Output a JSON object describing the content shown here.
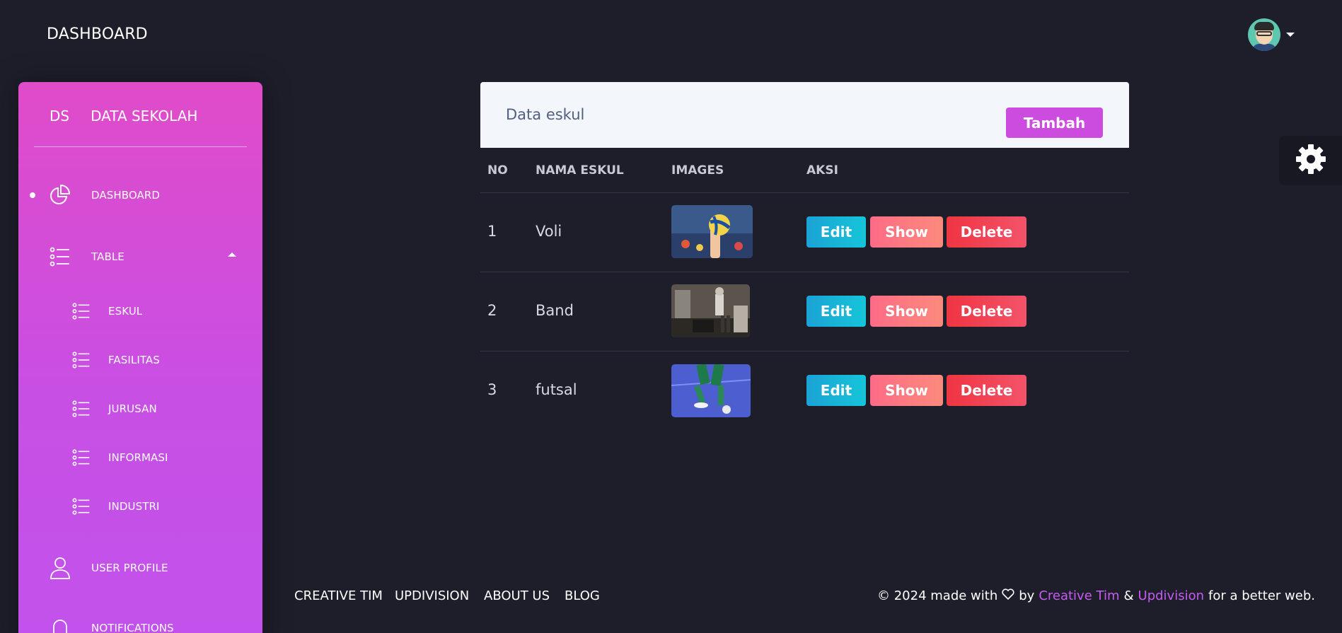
{
  "topbar": {
    "title": "DASHBOARD"
  },
  "sidebar": {
    "brand_short": "DS",
    "brand_name": "DATA SEKOLAH",
    "items": [
      {
        "label": "DASHBOARD",
        "icon": "chart-pie-icon",
        "active": true
      },
      {
        "label": "TABLE",
        "icon": "list-icon",
        "expanded": true
      },
      {
        "label": "ESKUL",
        "icon": "list-icon"
      },
      {
        "label": "FASILITAS",
        "icon": "list-icon"
      },
      {
        "label": "JURUSAN",
        "icon": "list-icon"
      },
      {
        "label": "INFORMASI",
        "icon": "list-icon"
      },
      {
        "label": "INDUSTRI",
        "icon": "list-icon"
      },
      {
        "label": "USER PROFILE",
        "icon": "user-icon"
      },
      {
        "label": "NOTIFICATIONS",
        "icon": "bell-icon"
      }
    ]
  },
  "card": {
    "title": "Data eskul",
    "add_label": "Tambah",
    "columns": [
      "NO",
      "NAMA ESKUL",
      "IMAGES",
      "AKSI"
    ],
    "rows": [
      {
        "no": "1",
        "name": "Voli",
        "image": "volleyball-photo"
      },
      {
        "no": "2",
        "name": "Band",
        "image": "band-photo"
      },
      {
        "no": "3",
        "name": "futsal",
        "image": "futsal-photo"
      }
    ],
    "actions": {
      "edit": "Edit",
      "show": "Show",
      "delete": "Delete"
    }
  },
  "footer": {
    "links": [
      "CREATIVE TIM",
      "UPDIVISION",
      "ABOUT US",
      "BLOG"
    ],
    "copyright_prefix": "© 2024 made with",
    "by": "by",
    "brand1": "Creative Tim",
    "amp": "&",
    "brand2": "Updivision",
    "suffix": "for a better web."
  },
  "colors": {
    "background": "#1e1e2b",
    "sidebar_gradient_top": "#e04bc9",
    "sidebar_gradient_bottom": "#c252ec",
    "accent": "#cc4ce0",
    "edit": "#16c5d8",
    "show": "#fd6b86",
    "delete": "#f03542"
  }
}
